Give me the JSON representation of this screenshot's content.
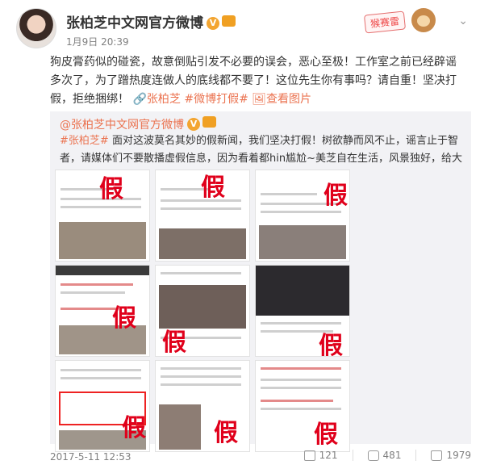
{
  "post": {
    "author": "张柏芝中文网官方微博",
    "verified_glyph": "V",
    "time": "1月9日 20:39",
    "sticker": "猴赛雷",
    "text_before": "狗皮膏药似的碰瓷，故意倒贴引发不必要的误会，恶心至极！工作室之前已经辟谣多次了，为了蹭热度连做人的底线都不要了！这位先生你有事吗？请自重！坚决打假，拒绝捆绑！",
    "link1": "张柏芝",
    "link2": "#微博打假#",
    "link3": "查看图片"
  },
  "repost": {
    "author": "@张柏芝中文网官方微博",
    "tag": "#张柏芝#",
    "text": "面对这波莫名其妙的假新闻，我们坚决打假！树欲静而风不止，谣言止于智者，请媒体们不要散播虚假信息，因为看着都hin尴尬~美芝自在生活，风景独好，给大家比心",
    "fake_label": "假",
    "timestamp": "2017-5-11 12:53",
    "share_count": "121",
    "comment_count": "481",
    "like_count": "1979"
  },
  "icons": [
    "chevron-down-icon",
    "share-icon",
    "comment-icon",
    "like-icon",
    "verified-icon",
    "vip-icon"
  ],
  "colors": {
    "accent": "#eb7350",
    "fake": "#e0001b",
    "repost_bg": "#f2f2f5"
  }
}
